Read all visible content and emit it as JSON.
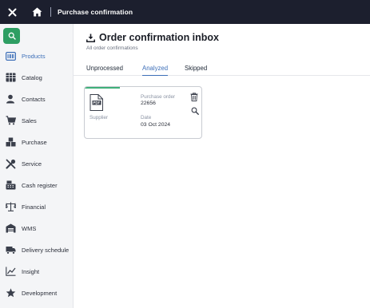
{
  "topbar": {
    "title": "Purchase confirmation",
    "close_icon": "close-icon",
    "home_icon": "home-icon"
  },
  "sidebar": {
    "search_icon": "search-icon",
    "accent_color": "#2e9e63",
    "items": [
      {
        "label": "Products",
        "icon": "products-icon",
        "active": true
      },
      {
        "label": "Catalog",
        "icon": "catalog-icon",
        "active": false
      },
      {
        "label": "Contacts",
        "icon": "contacts-icon",
        "active": false
      },
      {
        "label": "Sales",
        "icon": "sales-cart-icon",
        "active": false
      },
      {
        "label": "Purchase",
        "icon": "purchase-icon",
        "active": false
      },
      {
        "label": "Service",
        "icon": "service-tools-icon",
        "active": false
      },
      {
        "label": "Cash register",
        "icon": "cash-register-icon",
        "active": false
      },
      {
        "label": "Financial",
        "icon": "scales-icon",
        "active": false
      },
      {
        "label": "WMS",
        "icon": "warehouse-icon",
        "active": false
      },
      {
        "label": "Delivery schedule",
        "icon": "truck-icon",
        "active": false
      },
      {
        "label": "Insight",
        "icon": "chart-line-icon",
        "active": false
      },
      {
        "label": "Development",
        "icon": "star-icon",
        "active": false
      }
    ]
  },
  "main": {
    "title": "Order confirmation inbox",
    "subtitle": "All order confirmations",
    "tabs": [
      {
        "label": "Unprocessed",
        "active": false
      },
      {
        "label": "Analyzed",
        "active": true
      },
      {
        "label": "Skipped",
        "active": false
      }
    ],
    "card": {
      "purchase_order_label": "Purchase order",
      "purchase_order_value": "22656",
      "supplier_label": "Supplier",
      "date_label": "Date",
      "date_value": "03 Oct 2024",
      "status_color": "#3fb07a"
    }
  }
}
